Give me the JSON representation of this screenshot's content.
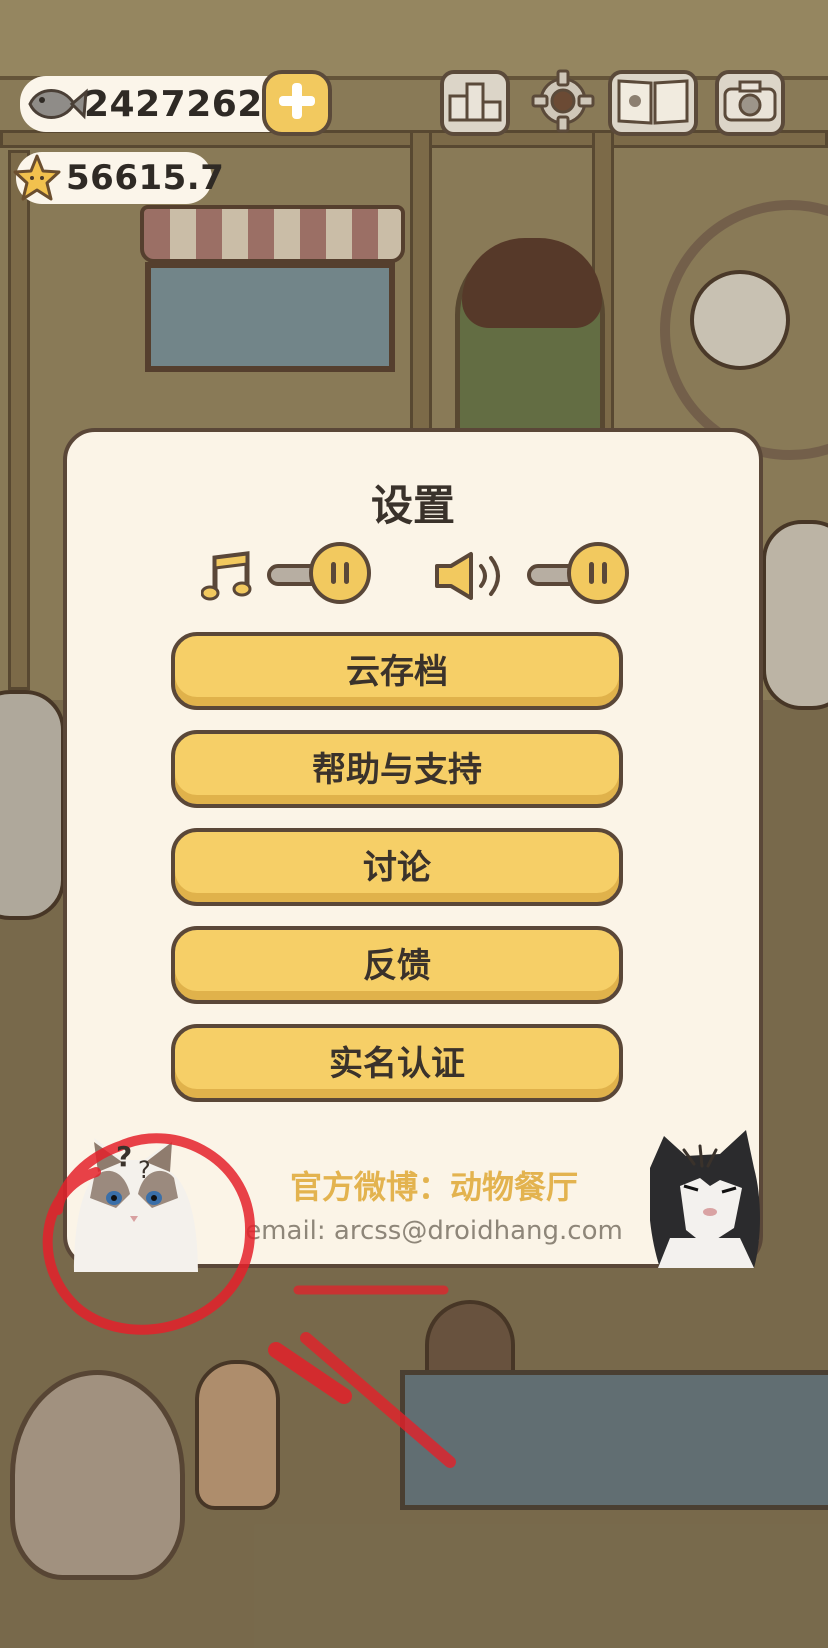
{
  "hud": {
    "fish_count": "2427262",
    "star_count": "56615.7",
    "icons": [
      "fish-icon",
      "star-icon",
      "plus-icon",
      "podium-icon",
      "gear-icon",
      "book-icon",
      "camera-icon"
    ]
  },
  "settings": {
    "title": "设置",
    "music_icon": "music-note-icon",
    "sound_icon": "speaker-icon",
    "buttons": {
      "cloud_save": "云存档",
      "help_support": "帮助与支持",
      "discussion": "讨论",
      "feedback": "反馈",
      "real_name": "实名认证"
    },
    "weibo": "官方微博：动物餐厅",
    "email": "email: arcss@droidhang.com"
  },
  "colors": {
    "panel_bg": "#fbf4e7",
    "button_yellow": "#f6cf67",
    "outline_brown": "#5a4738",
    "weibo_gold": "#e3b34f",
    "annotation_red": "#e4212a"
  }
}
